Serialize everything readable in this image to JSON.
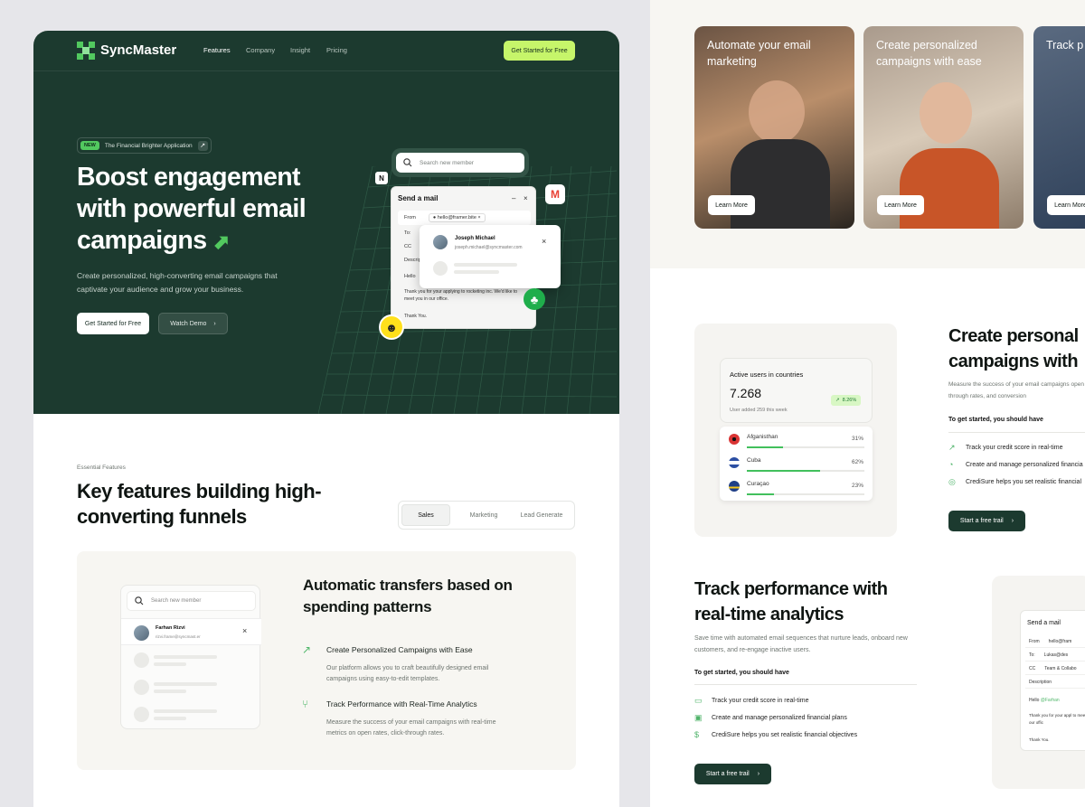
{
  "brand": {
    "name": "SyncMaster",
    "accent": "#c6f56a",
    "dark": "#1c3a2f",
    "green": "#52c95f"
  },
  "nav": {
    "items": [
      "Features",
      "Company",
      "Insight",
      "Pricing"
    ],
    "cta": "Get Started for Free"
  },
  "hero": {
    "badge_new": "NEW",
    "badge_text": "The Financial Brighter Application",
    "title": "Boost engagement with powerful email campaigns",
    "subtitle": "Create personalized, high-converting email campaigns that captivate your audience and grow your business.",
    "primary_btn": "Get Started for Free",
    "secondary_btn": "Watch Demo"
  },
  "hero_mock": {
    "search_placeholder": "Search new member",
    "mail_title": "Send a mail",
    "from_label": "From",
    "from_value": "hello@framer.bite",
    "to_label": "To:",
    "cc_label": "CC",
    "desc_label": "Descrip",
    "hello_text": "Hello",
    "body_text": "Thank you for your applying to rocketing inc. We'd like to meet you in our office.",
    "thanks": "Thank You.",
    "contact_name": "Joseph Michael",
    "contact_email": "joseph.michael@syncmaster.com"
  },
  "features": {
    "eyebrow": "Essential Features",
    "title": "Key features building high-converting funnels",
    "tabs": [
      "Sales",
      "Marketing",
      "Lead Generate"
    ],
    "panel_search": "Search new member",
    "panel_contact_name": "Farhan Rizvi",
    "panel_contact_email": "rizvi.frame@syncmast.er",
    "panel_title": "Automatic transfers based on spending patterns",
    "items": [
      {
        "title": "Create Personalized Campaigns with Ease",
        "desc": "Our platform allows you to craft beautifully designed email campaigns using easy-to-edit templates."
      },
      {
        "title": "Track Performance with Real-Time Analytics",
        "desc": "Measure the success of your email campaigns with real-time metrics on open rates, click-through rates."
      }
    ]
  },
  "cards": [
    {
      "caption": "Automate your email marketing",
      "button": "Learn More"
    },
    {
      "caption": "Create personalized campaigns with ease",
      "button": "Learn More"
    },
    {
      "caption": "Track p real-tim",
      "button": "Learn More"
    }
  ],
  "active_users": {
    "title": "Active users in countries",
    "value": "7.268",
    "delta": "8.26%",
    "note": "User added 259 this week",
    "countries": [
      {
        "name": "Afganisthan",
        "pct": "31%",
        "fraction": 0.31
      },
      {
        "name": "Cuba",
        "pct": "62%",
        "fraction": 0.62
      },
      {
        "name": "Curaçao",
        "pct": "23%",
        "fraction": 0.23
      }
    ]
  },
  "section_personal": {
    "title": "Create personal campaigns with",
    "desc": "Measure the success of your email campaigns open rates, click-through rates, and conversion",
    "subhead": "To get started, you should have",
    "items": [
      "Track your credit score in real-time",
      "Create and manage personalized financia",
      "CrediSure helps you set realistic financial"
    ],
    "button": "Start a free trail"
  },
  "section_track": {
    "title": "Track performance with real-time analytics",
    "desc": "Save time with automated email sequences that nurture leads, onboard new customers, and re-engage inactive users.",
    "subhead": "To get started, you should have",
    "items": [
      "Track your credit score in real-time",
      "Create and manage personalized financial plans",
      "CrediSure helps you set realistic financial objectives"
    ],
    "button": "Start a free trail"
  },
  "send_mail_small": {
    "title": "Send a mail",
    "from": "From",
    "from_value": "hello@fram",
    "to": "To:",
    "to_value": "Lukas@des",
    "cc": "CC",
    "cc_value": "Team & Collabo",
    "desc": "Description",
    "hello": "Hello",
    "mention": "@Farhan",
    "body": "Thank you for your appl to meet you in our offic",
    "thanks": "Thank You."
  }
}
